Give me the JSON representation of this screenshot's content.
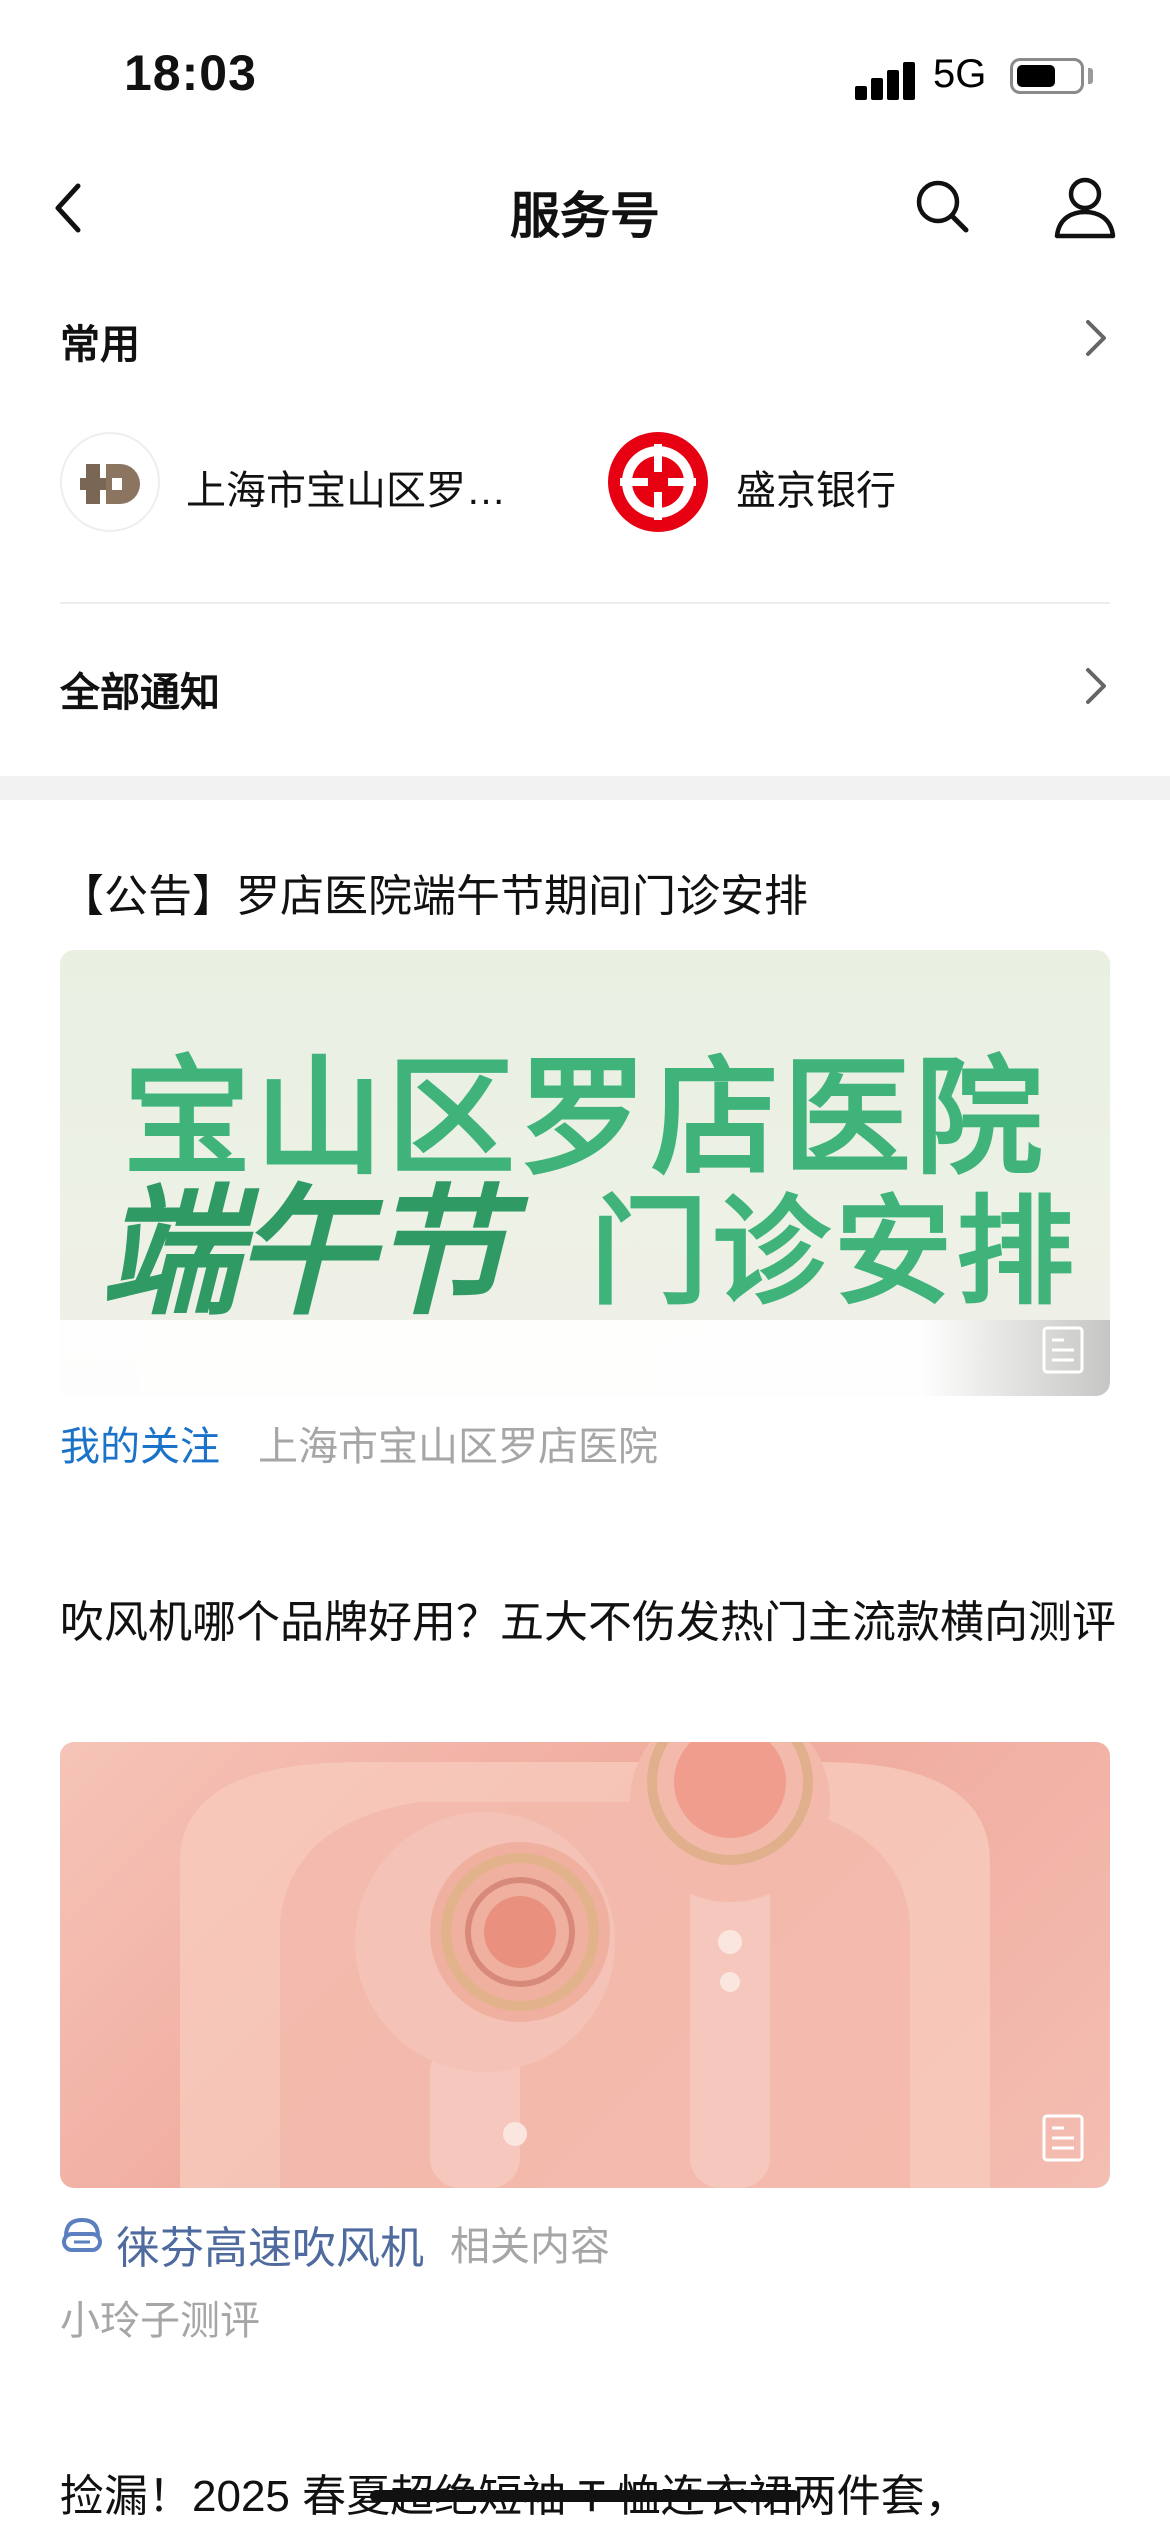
{
  "status_bar": {
    "time": "18:03",
    "network": "5G"
  },
  "nav": {
    "title": "服务号"
  },
  "frequent": {
    "label": "常用",
    "accounts": [
      {
        "name": "上海市宝山区罗…",
        "icon": "hospital-cross-logo"
      },
      {
        "name": "盛京银行",
        "icon": "bank-logo",
        "color": "#e60012"
      }
    ]
  },
  "all_notifications": {
    "label": "全部通知"
  },
  "feed": [
    {
      "title": "【公告】罗店医院端午节期间门诊安排",
      "banner_line1": "宝山区罗店医院",
      "banner_line2_calligraphy": "端午节",
      "banner_line2_rest": "门诊安排",
      "tag": "我的关注",
      "source": "上海市宝山区罗店医院"
    },
    {
      "title": "吹风机哪个品牌好用？五大不伤发热门主流款横向测评",
      "product": "徕芬高速吹风机",
      "related": "相关内容",
      "source": "小玲子测评"
    },
    {
      "title": "捡漏！2025 春夏超绝短袖 T 恤连衣裙两件套，"
    }
  ],
  "colors": {
    "accent_blue": "#1a73c9",
    "banner_green": "#3fb37a",
    "meta_gray": "#a6a6a6"
  }
}
